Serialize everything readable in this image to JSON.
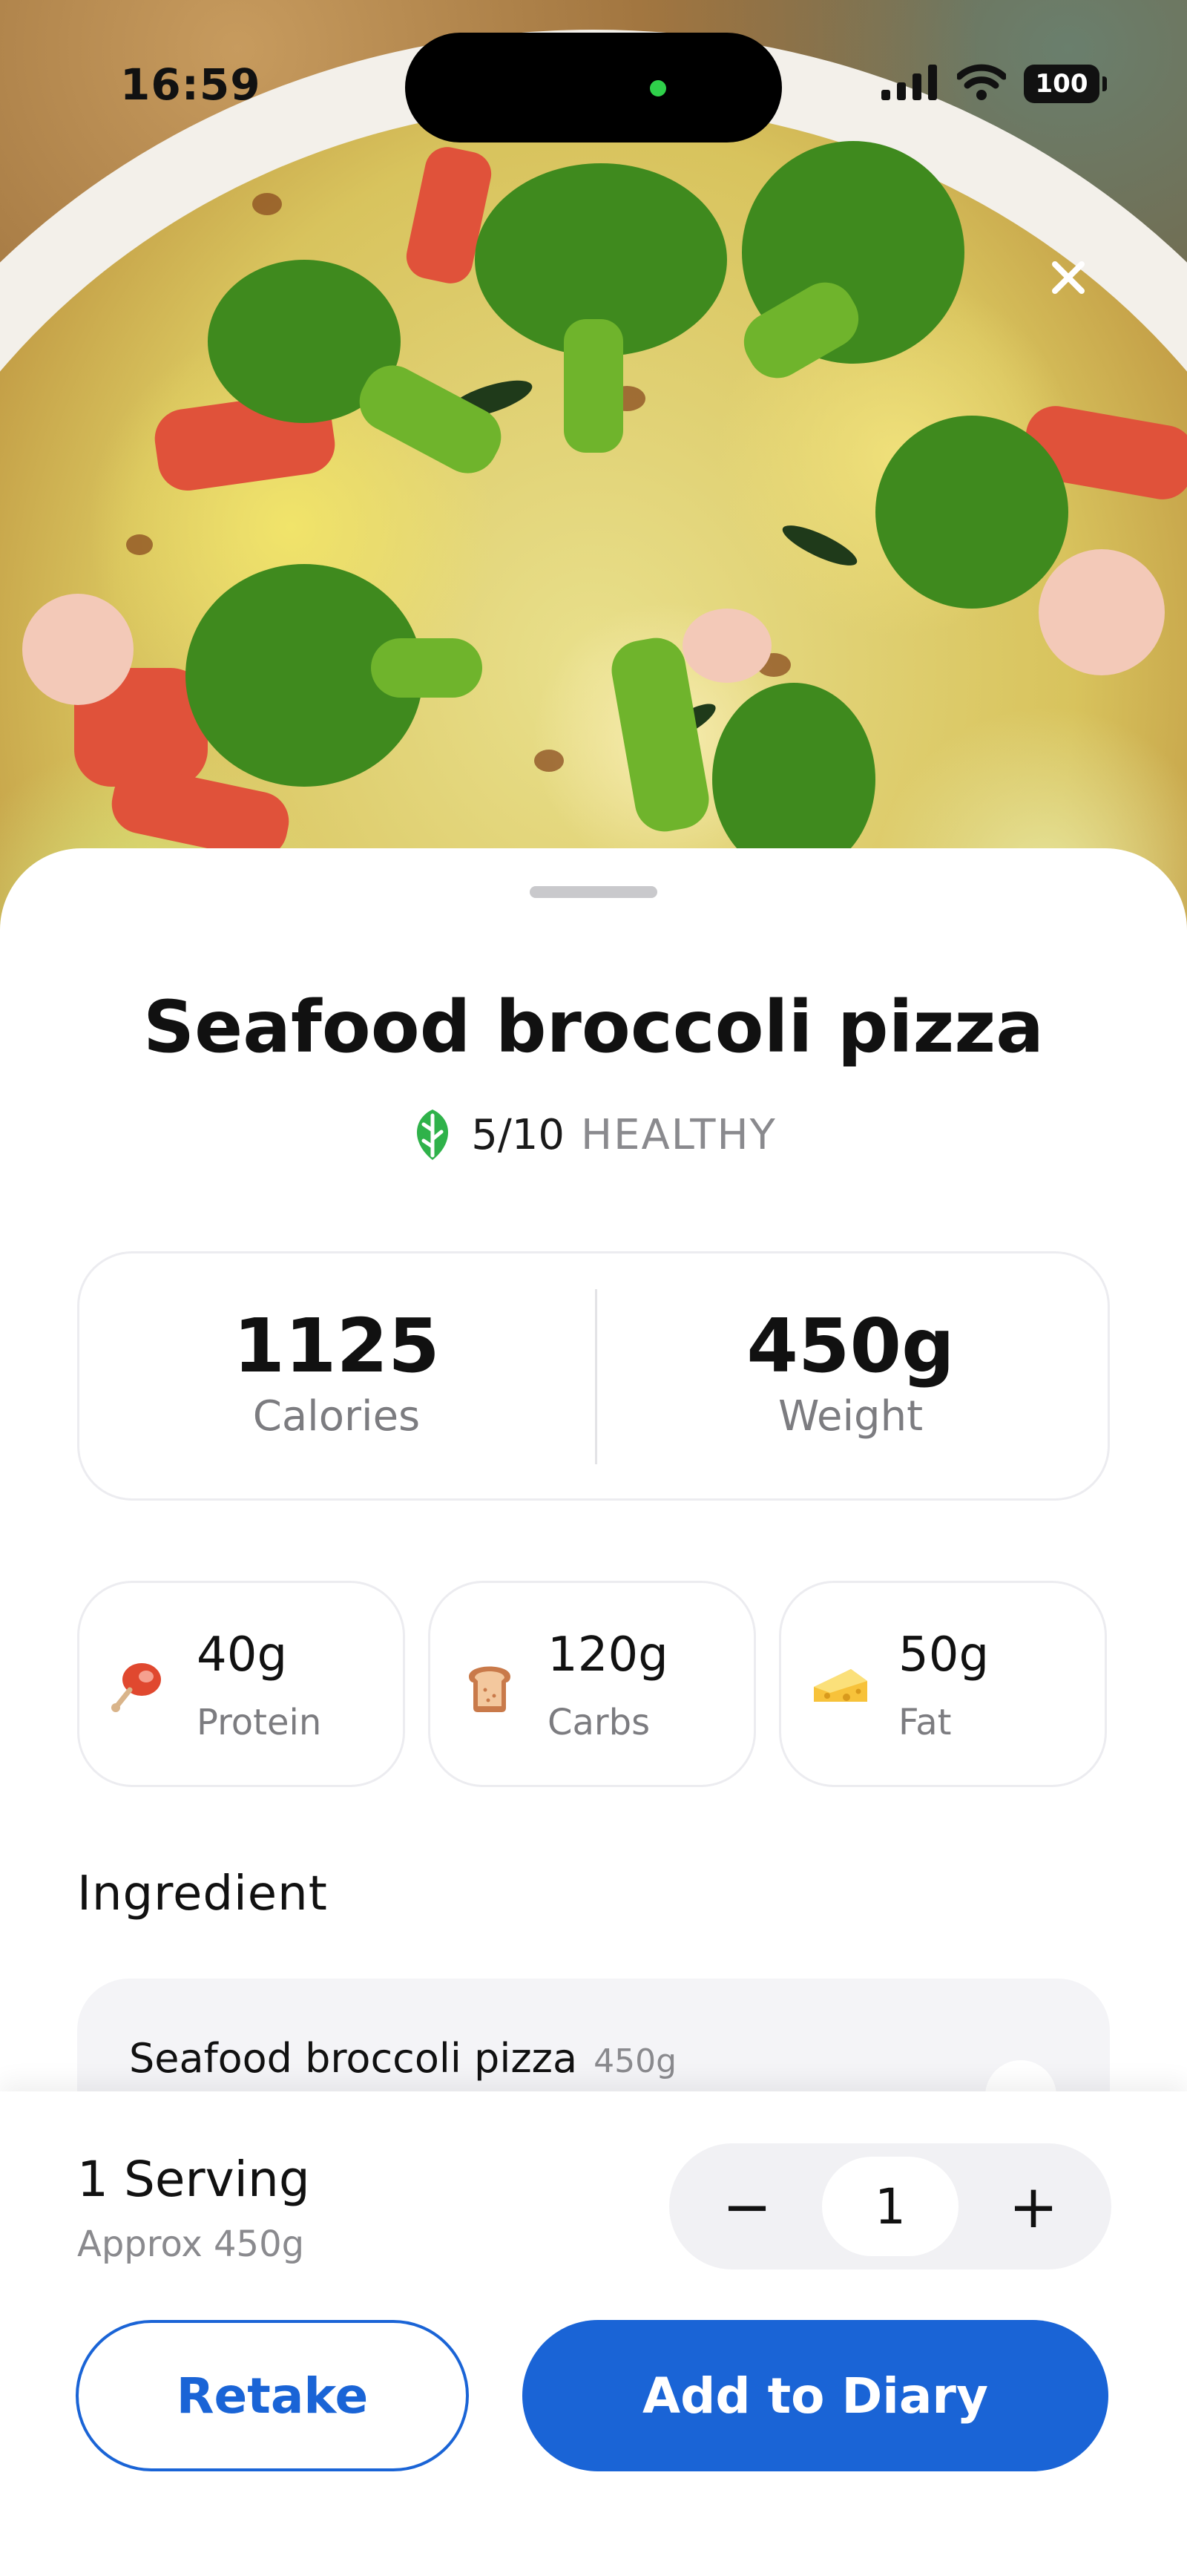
{
  "status_bar": {
    "time": "16:59",
    "battery": "100",
    "icons": [
      "signal-icon",
      "wifi-icon",
      "battery-icon"
    ]
  },
  "header": {
    "close_icon": "close-icon"
  },
  "food": {
    "name": "Seafood broccoli pizza",
    "health_score": "5/10",
    "health_label": "HEALTHY",
    "health_icon": "leaf-icon"
  },
  "summary": {
    "calories_value": "1125",
    "calories_label": "Calories",
    "weight_value": "450g",
    "weight_label": "Weight"
  },
  "macros": [
    {
      "value": "40g",
      "label": "Protein",
      "icon": "meat-icon"
    },
    {
      "value": "120g",
      "label": "Carbs",
      "icon": "bread-icon"
    },
    {
      "value": "50g",
      "label": "Fat",
      "icon": "cheese-icon"
    }
  ],
  "ingredients": {
    "title": "Ingredient",
    "items": [
      {
        "name": "Seafood broccoli pizza",
        "weight": "450g"
      }
    ]
  },
  "serving": {
    "label": "1 Serving",
    "approx": "Approx 450g",
    "quantity": "1",
    "minus": "−",
    "plus": "+"
  },
  "actions": {
    "retake": "Retake",
    "add": "Add to Diary"
  },
  "colors": {
    "primary": "#1a64d6",
    "health_leaf": "#2fb24a"
  }
}
